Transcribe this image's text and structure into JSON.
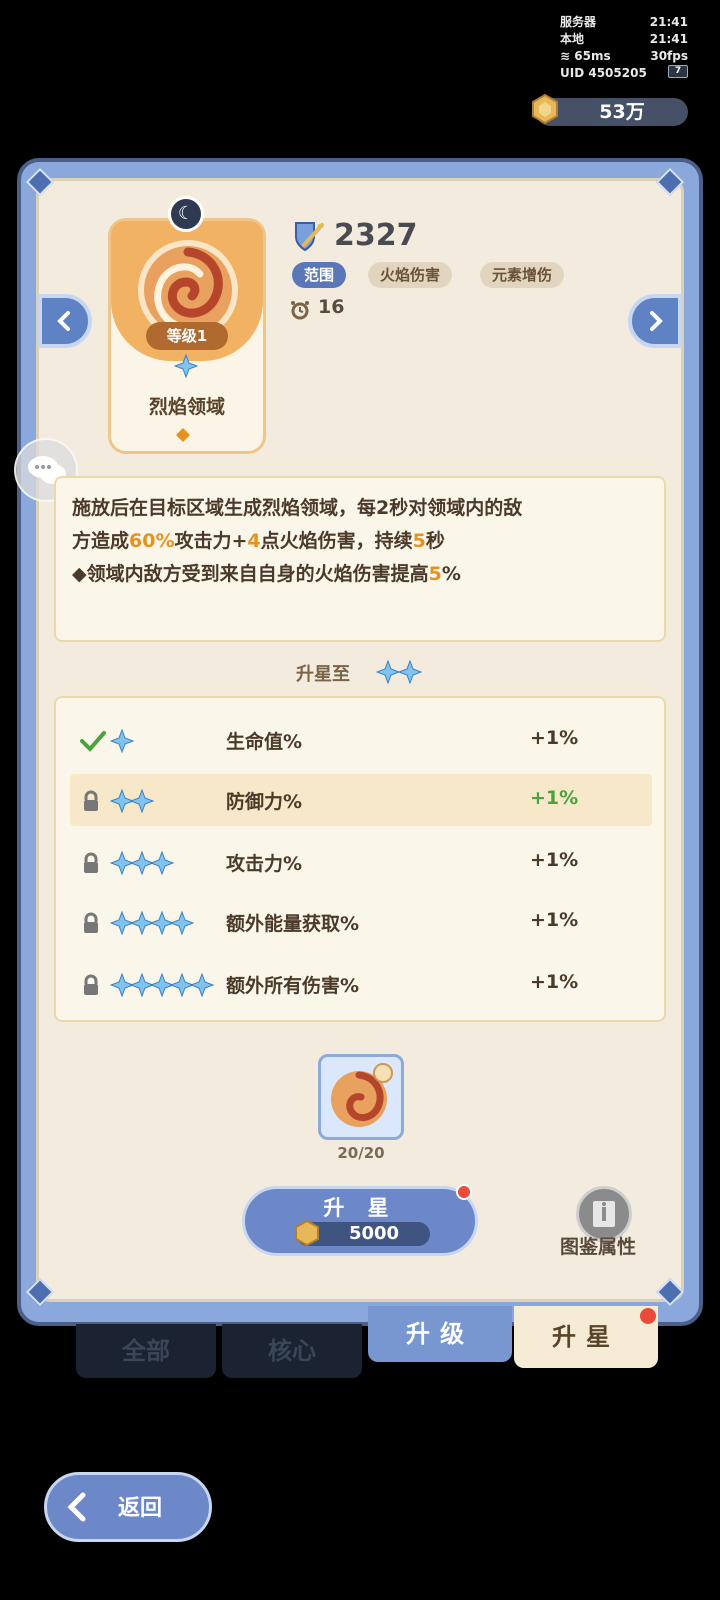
{
  "status": {
    "server_label": "服务器",
    "server_time": "21:41",
    "local_label": "本地",
    "local_time": "21:41",
    "ping": "65ms",
    "fps": "30fps",
    "uid": "UID 4505205",
    "battery": "7"
  },
  "currency": {
    "amount": "53万",
    "icon": "gold-coin-icon"
  },
  "skill": {
    "name": "烈焰领域",
    "level": "等级1",
    "power": "2327",
    "tags": [
      "范围",
      "火焰伤害",
      "元素增伤"
    ],
    "cooldown": "16",
    "description": {
      "line1": "施放后在目标区域生成烈焰领域，每2秒对领域内的敌",
      "line2_a": "方造成",
      "line2_b": "60%",
      "line2_c": "攻击力+",
      "line2_d": "4",
      "line2_e": "点火焰伤害，持续",
      "line2_f": "5",
      "line2_g": "秒",
      "line3_a": "◆领域内敌方受到来自自身的火焰伤害提高",
      "line3_b": "5",
      "line3_c": "%"
    }
  },
  "upgrade": {
    "title": "升星至",
    "target_stars": 2,
    "rows": [
      {
        "status": "unlocked",
        "stars": 1,
        "name": "生命值%",
        "value": "+1%"
      },
      {
        "status": "locked",
        "stars": 2,
        "name": "防御力%",
        "value": "+1%"
      },
      {
        "status": "locked",
        "stars": 3,
        "name": "攻击力%",
        "value": "+1%"
      },
      {
        "status": "locked",
        "stars": 4,
        "name": "额外能量获取%",
        "value": "+1%"
      },
      {
        "status": "locked",
        "stars": 5,
        "name": "额外所有伤害%",
        "value": "+1%"
      }
    ]
  },
  "material": {
    "count": "20/20"
  },
  "upgrade_button": {
    "label": "升 星",
    "cost": "5000"
  },
  "codex": {
    "label": "图鉴属性"
  },
  "tabs": {
    "all": "全部",
    "core": "核心",
    "upgrade": "升级",
    "upstar": "升星"
  },
  "back": {
    "label": "返回"
  },
  "colors": {
    "accent": "#6c88c8",
    "highlight": "#e6921f",
    "positive": "#4ca33d",
    "panel": "#f3ecde"
  }
}
